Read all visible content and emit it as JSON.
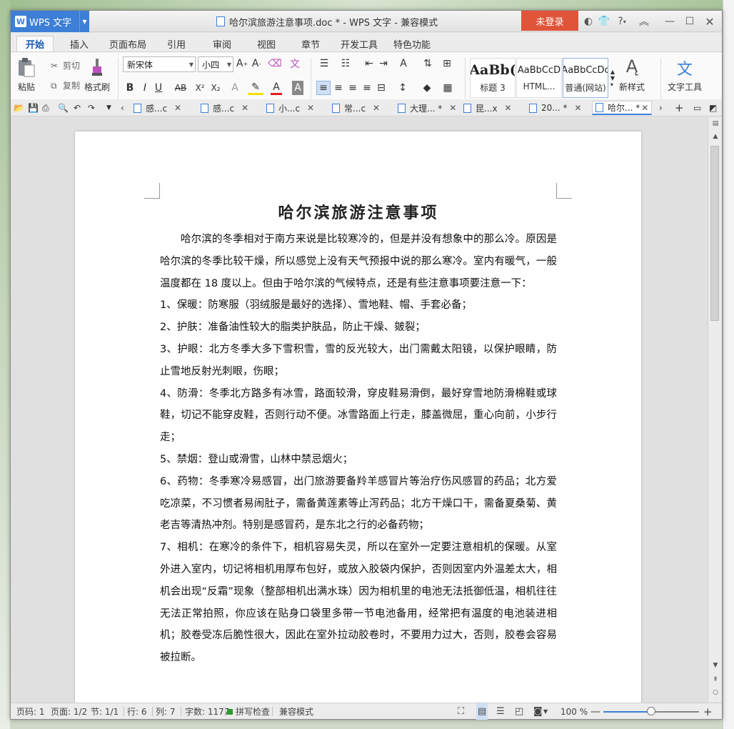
{
  "app": {
    "menu_label": "WPS 文字",
    "doc_title": "哈尔滨旅游注意事项.doc * - WPS 文字 - 兼容模式",
    "login_label": "未登录",
    "help_label": "?"
  },
  "ribbon_tabs": [
    "开始",
    "插入",
    "页面布局",
    "引用",
    "审阅",
    "视图",
    "章节",
    "开发工具",
    "特色功能"
  ],
  "ribbon": {
    "paste_label": "粘贴",
    "cut_label": "剪切",
    "copy_label": "复制",
    "format_painter_label": "格式刷",
    "font_name": "新宋体",
    "font_size": "小四",
    "styles": [
      {
        "sample": "AaBb(",
        "name": "标题 3"
      },
      {
        "sample": "AaBbCcD",
        "name": "HTML..."
      },
      {
        "sample": "AaBbCcDc",
        "name": "普通(网站)"
      }
    ],
    "new_style_label": "新样式",
    "text_tools_label": "文字工具"
  },
  "doc_tabs": [
    {
      "label": "感...c"
    },
    {
      "label": "感...c"
    },
    {
      "label": "小...c"
    },
    {
      "label": "常...c"
    },
    {
      "label": "大理... *"
    },
    {
      "label": "昆...x"
    },
    {
      "label": "20... *"
    },
    {
      "label": "哈尔... *"
    }
  ],
  "document": {
    "title": "哈尔滨旅游注意事项",
    "paragraphs": [
      "哈尔滨的冬季相对于南方来说是比较寒冷的，但是并没有想象中的那么冷。原因是哈尔滨的冬季比较干燥，所以感觉上没有天气预报中说的那么寒冷。室内有暖气，一般温度都在 18 度以上。但由于哈尔滨的气候特点，还是有些注意事项要注意一下：",
      "1、保暖：防寒服（羽绒服是最好的选择）、雪地鞋、帽、手套必备；",
      "2、护肤：准备油性较大的脂类护肤品，防止干燥、皴裂；",
      "3、护眼：北方冬季大多下雪积雪，雪的反光较大，出门需戴太阳镜，以保护眼睛，防止雪地反射光刺眼，伤眼；",
      "4、防滑：冬季北方路多有冰雪，路面较滑，穿皮鞋易滑倒，最好穿雪地防滑棉鞋或球鞋，切记不能穿皮鞋，否则行动不便。冰雪路面上行走，膝盖微屈，重心向前，小步行走；",
      "5、禁烟：登山或滑雪，山林中禁忌烟火；",
      "6、药物：冬季寒冷易感冒，出门旅游要备羚羊感冒片等治疗伤风感冒的药品；北方爱吃凉菜，不习惯者易闹肚子，需备黄莲素等止泻药品；北方干燥口干，需备夏桑菊、黄老吉等清热冲剂。特别是感冒药，是东北之行的必备药物；",
      "7、相机：在寒冷的条件下，相机容易失灵，所以在室外一定要注意相机的保暖。从室外进入室内，切记将相机用厚布包好，或放入胶袋内保护，否则因室内外温差太大，相机会出现“反霜”现象（整部相机出满水珠）因为相机里的电池无法抵御低温，相机往往无法正常拍照，你应该在贴身口袋里多带一节电池备用，经常把有温度的电池装进相机；胶卷受冻后脆性很大，因此在室外拉动胶卷时，不要用力过大，否则，胶卷会容易被拉断。"
    ]
  },
  "status": {
    "page_code": "页码: 1",
    "pages": "页面: 1/2",
    "section": "节: 1/1",
    "row": "行: 6",
    "col": "列: 7",
    "words": "字数: 1177",
    "spell": "拼写检查",
    "compat": "兼容模式",
    "zoom": "100 %",
    "zoom_fraction": 0.5
  },
  "colors": {
    "accent": "#3d7fd6",
    "login": "#e0553a"
  }
}
